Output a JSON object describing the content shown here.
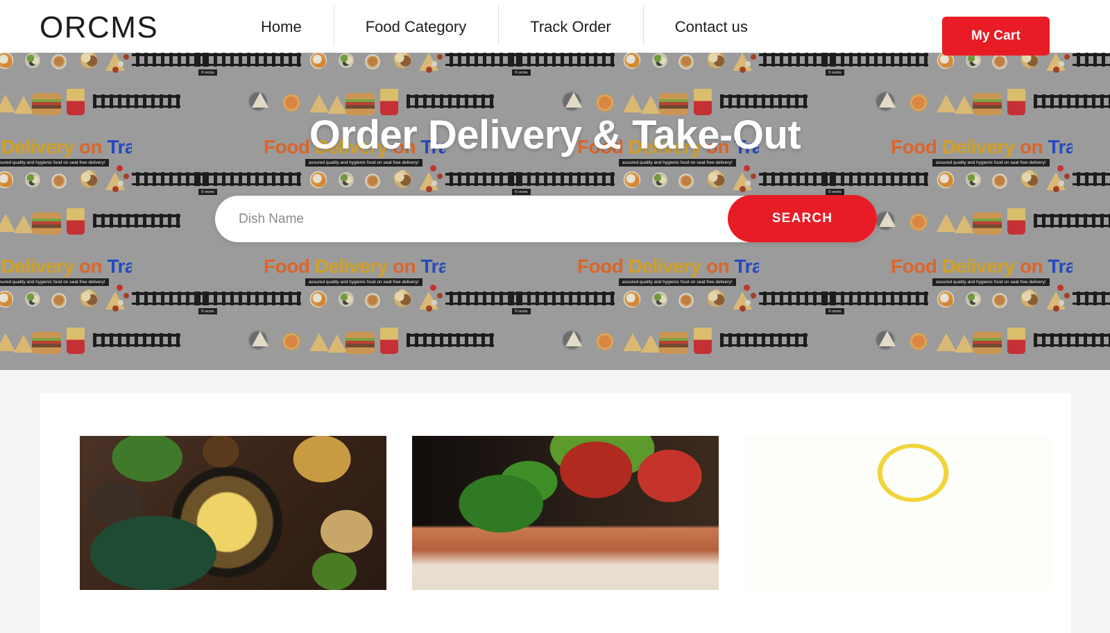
{
  "header": {
    "logo": "ORCMS",
    "nav": [
      {
        "label": "Home"
      },
      {
        "label": "Food Category"
      },
      {
        "label": "Track Order"
      },
      {
        "label": "Contact us"
      }
    ],
    "cart_button": "My Cart",
    "accent_color": "#e81c24"
  },
  "hero": {
    "title": "Order Delivery & Take-Out",
    "search": {
      "placeholder": "Dish Name",
      "value": "",
      "button_label": "SEARCH"
    },
    "background_pattern": {
      "brand_word1": "Food",
      "brand_word2": "Delivery",
      "brand_word3": "on",
      "brand_word4": "Trains",
      "tagline": "assured quality and hygienic food on seat free delivery!",
      "watermark": "© orcms",
      "colors": {
        "base": "#a0a0a0",
        "word1": "#e8621f",
        "word2": "#e0a517",
        "word3": "#e8621f",
        "word4": "#1a44c8",
        "rail": "#111111"
      }
    }
  },
  "main": {
    "dishes": [
      {
        "name": "",
        "price": "",
        "image_alt": "creamy-polenta-with-mushrooms"
      },
      {
        "name": "",
        "price": "",
        "image_alt": "lasagna-with-basil"
      },
      {
        "name": "",
        "price": "",
        "image_alt": "thai-basil-chicken-with-rice-and-fried-egg"
      }
    ]
  }
}
